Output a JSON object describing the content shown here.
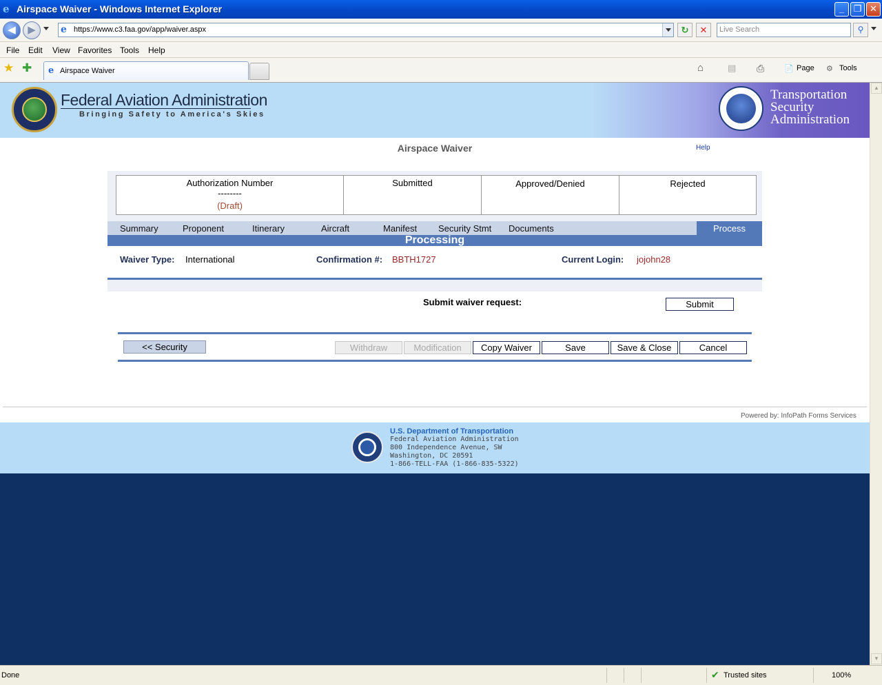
{
  "window": {
    "title": "Airspace Waiver - Windows Internet Explorer"
  },
  "address": {
    "url": "https://www.c3.faa.gov/app/waiver.aspx",
    "search_placeholder": "Live Search"
  },
  "menu": [
    "File",
    "Edit",
    "View",
    "Favorites",
    "Tools",
    "Help"
  ],
  "tab": {
    "label": "Airspace Waiver"
  },
  "commands": {
    "page": "Page",
    "tools": "Tools"
  },
  "header": {
    "faa_title": "Federal Aviation Administration",
    "faa_subtitle": "Bringing Safety to America's Skies",
    "tsa_line1": "Transportation",
    "tsa_line2": "Security",
    "tsa_line3": "Administration"
  },
  "page": {
    "title": "Airspace Waiver",
    "help": "Help"
  },
  "status": {
    "auth_label": "Authorization Number",
    "auth_value": "--------",
    "auth_state": "(Draft)",
    "submitted": "Submitted",
    "approved": "Approved/Denied",
    "rejected": "Rejected"
  },
  "nav": [
    "Summary",
    "Proponent",
    "Itinerary",
    "Aircraft",
    "Manifest",
    "Security Stmt",
    "Documents",
    "Process"
  ],
  "section": {
    "title": "Processing"
  },
  "info": {
    "waiver_type_label": "Waiver Type:",
    "waiver_type": "International",
    "confirmation_label": "Confirmation #:",
    "confirmation": "BBTH1727",
    "login_label": "Current Login:",
    "login": "jojohn28"
  },
  "submit": {
    "label": "Submit waiver request:",
    "button": "Submit"
  },
  "actions": {
    "back": "<< Security",
    "withdraw": "Withdraw",
    "modification": "Modification",
    "copy": "Copy Waiver",
    "save": "Save",
    "save_close": "Save & Close",
    "cancel": "Cancel"
  },
  "footer": {
    "powered": "Powered by: InfoPath Forms Services",
    "dept": "U.S. Department of Transportation",
    "line1": "Federal Aviation Administration",
    "line2": "800 Independence Avenue, SW",
    "line3": "Washington, DC 20591",
    "line4": "1-866-TELL-FAA (1-866-835-5322)"
  },
  "statusbar": {
    "done": "Done",
    "zone": "Trusted sites",
    "zoom": "100%"
  }
}
